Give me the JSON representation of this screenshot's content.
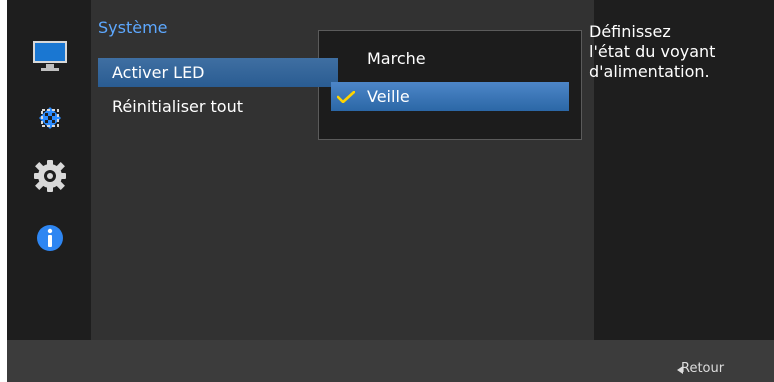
{
  "menu": {
    "title": "Système",
    "items": [
      {
        "label": "Activer LED"
      },
      {
        "label": "Réinitialiser tout"
      }
    ]
  },
  "submenu": {
    "options": [
      {
        "label": "Marche"
      },
      {
        "label": "Veille"
      }
    ]
  },
  "description": {
    "line1": "Définissez",
    "line2": "l'état du voyant",
    "line3": "d'alimentation."
  },
  "bottom": {
    "retour_label": "Retour"
  },
  "colors": {
    "title_color": "#5da8ff",
    "accent_blue": "#2b67a6",
    "check_yellow": "#ffd400"
  },
  "icons": [
    "monitor-icon",
    "move-icon",
    "gear-icon",
    "info-icon"
  ]
}
